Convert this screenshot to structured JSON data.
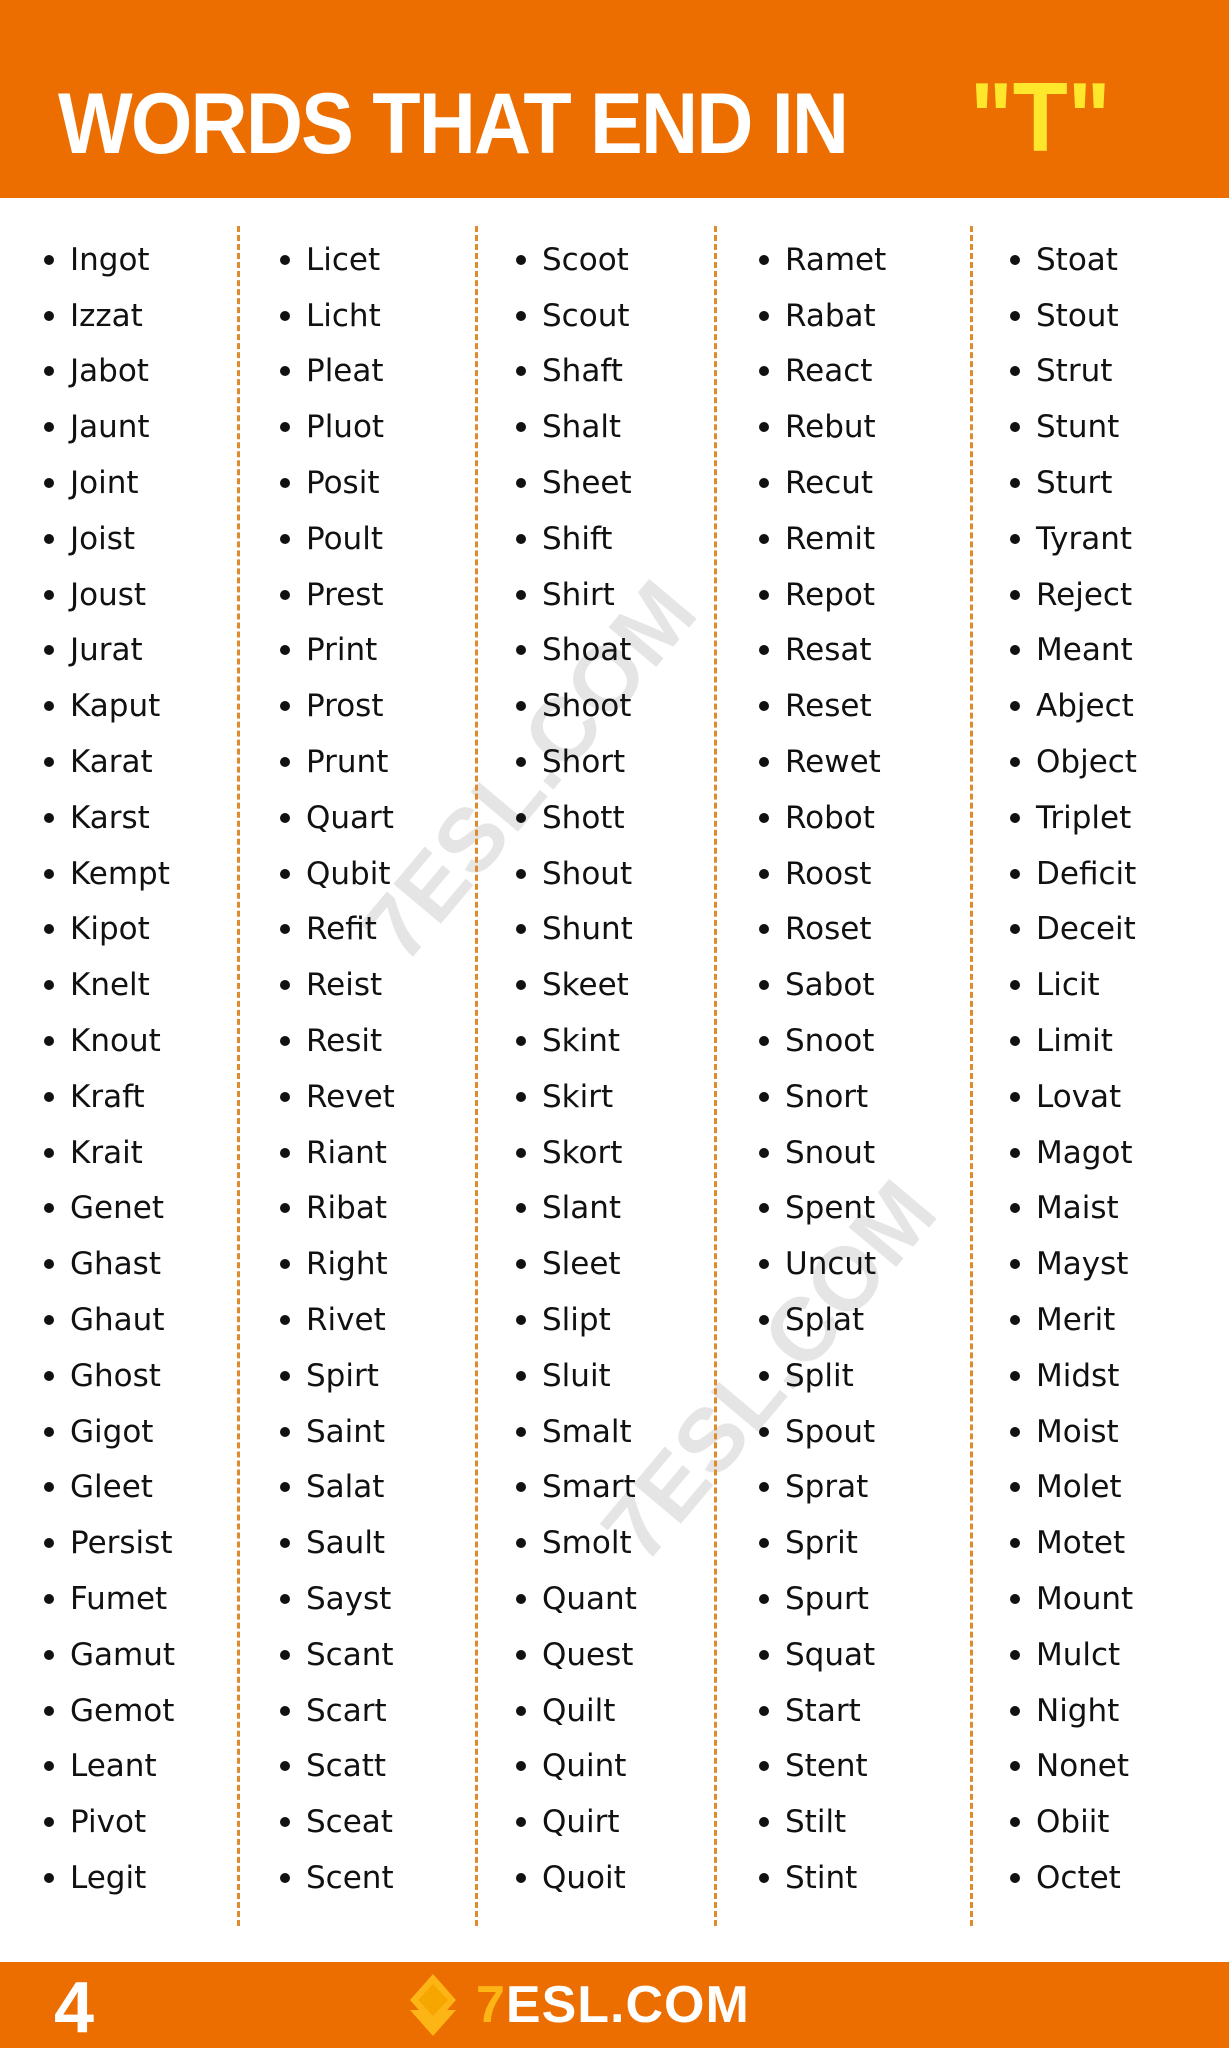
{
  "header": {
    "title": "WORDS THAT END IN",
    "letter": "\"T\""
  },
  "columns": [
    {
      "words": [
        "Ingot",
        "Izzat",
        "Jabot",
        "Jaunt",
        "Joint",
        "Joist",
        "Joust",
        "Jurat",
        "Kaput",
        "Karat",
        "Karst",
        "Kempt",
        "Kipot",
        "Knelt",
        "Knout",
        "Kraft",
        "Krait",
        "Genet",
        "Ghast",
        "Ghaut",
        "Ghost",
        "Gigot",
        "Gleet",
        "Persist",
        "Fumet",
        "Gamut",
        "Gemot",
        "Leant",
        "Pivot",
        "Legit"
      ]
    },
    {
      "words": [
        "Licet",
        "Licht",
        "Pleat",
        "Pluot",
        "Posit",
        "Poult",
        "Prest",
        "Print",
        "Prost",
        "Prunt",
        "Quart",
        "Qubit",
        "Refit",
        "Reist",
        "Resit",
        "Revet",
        "Riant",
        "Ribat",
        "Right",
        "Rivet",
        "Spirt",
        "Saint",
        "Salat",
        "Sault",
        "Sayst",
        "Scant",
        "Scart",
        "Scatt",
        "Sceat",
        "Scent"
      ]
    },
    {
      "words": [
        "Scoot",
        "Scout",
        "Shaft",
        "Shalt",
        "Sheet",
        "Shift",
        "Shirt",
        "Shoat",
        "Shoot",
        "Short",
        "Shott",
        "Shout",
        "Shunt",
        "Skeet",
        "Skint",
        "Skirt",
        "Skort",
        "Slant",
        "Sleet",
        "Slipt",
        "Sluit",
        "Smalt",
        "Smart",
        "Smolt",
        "Quant",
        "Quest",
        "Quilt",
        "Quint",
        "Quirt",
        "Quoit"
      ]
    },
    {
      "words": [
        "Ramet",
        "Rabat",
        "React",
        "Rebut",
        "Recut",
        "Remit",
        "Repot",
        "Resat",
        "Reset",
        "Rewet",
        "Robot",
        "Roost",
        "Roset",
        "Sabot",
        "Snoot",
        "Snort",
        "Snout",
        "Spent",
        "Uncut",
        "Splat",
        "Split",
        "Spout",
        "Sprat",
        "Sprit",
        "Spurt",
        "Squat",
        "Start",
        "Stent",
        "Stilt",
        "Stint"
      ]
    },
    {
      "words": [
        "Stoat",
        "Stout",
        "Strut",
        "Stunt",
        "Sturt",
        "Tyrant",
        "Reject",
        "Meant",
        "Abject",
        "Object",
        "Triplet",
        "Deficit",
        "Deceit",
        "Licit",
        "Limit",
        "Lovat",
        "Magot",
        "Maist",
        "Mayst",
        "Merit",
        "Midst",
        "Moist",
        "Molet",
        "Motet",
        "Mount",
        "Mulct",
        "Night",
        "Nonet",
        "Obiit",
        "Octet"
      ]
    }
  ],
  "footer": {
    "page_number": "4",
    "logo_seven": "7",
    "logo_text": "ESL.COM"
  },
  "watermark": "7ESL.COM",
  "colors": {
    "brand_orange": "#ec6e00",
    "accent_yellow": "#ffe82c",
    "divider": "#e08a2e"
  }
}
